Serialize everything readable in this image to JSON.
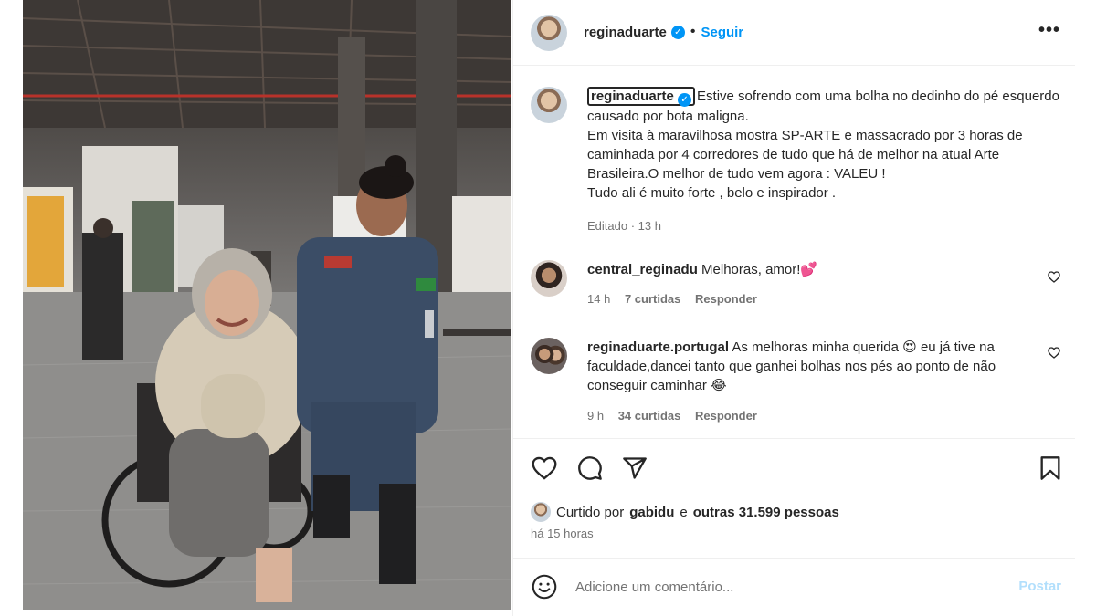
{
  "post": {
    "author": "reginaduarte",
    "separator": "•",
    "follow_label": "Seguir",
    "more_label": "•••",
    "caption": {
      "username": "reginaduarte",
      "text": "Estive sofrendo com uma bolha no dedinho do pé esquerdo causado por bota maligna.\nEm visita à maravilhosa mostra SP-ARTE e massacrado por 3 horas de caminhada por 4 corredores de tudo que há de melhor na atual Arte Brasileira.O melhor de tudo vem agora : VALEU !\nTudo ali é muito forte , belo e inspirador .",
      "meta": "Editado · 13 h"
    },
    "comments": [
      {
        "username": "central_reginadu",
        "text": "Melhoras, amor!💕",
        "time": "14 h",
        "likes": "7 curtidas",
        "reply_label": "Responder"
      },
      {
        "username": "reginaduarte.portugal",
        "text": "As melhoras minha querida 😍 eu já tive na faculdade,dancei tanto que ganhei bolhas nos pés ao ponto de não conseguir caminhar 😂",
        "time": "9 h",
        "likes": "34 curtidas",
        "reply_label": "Responder"
      }
    ],
    "liked_by": {
      "prefix": "Curtido por",
      "user": "gabidu",
      "conj": "e",
      "others": "outras 31.599 pessoas"
    },
    "time_ago": "há 15 horas",
    "comment_placeholder": "Adicione um comentário...",
    "post_label": "Postar",
    "icons": [
      "heart-icon",
      "comment-icon",
      "share-icon",
      "bookmark-icon",
      "emoji-icon"
    ],
    "colors": {
      "accent": "#0095f6",
      "post_disabled": "#b2dffc",
      "muted": "#737373"
    }
  }
}
